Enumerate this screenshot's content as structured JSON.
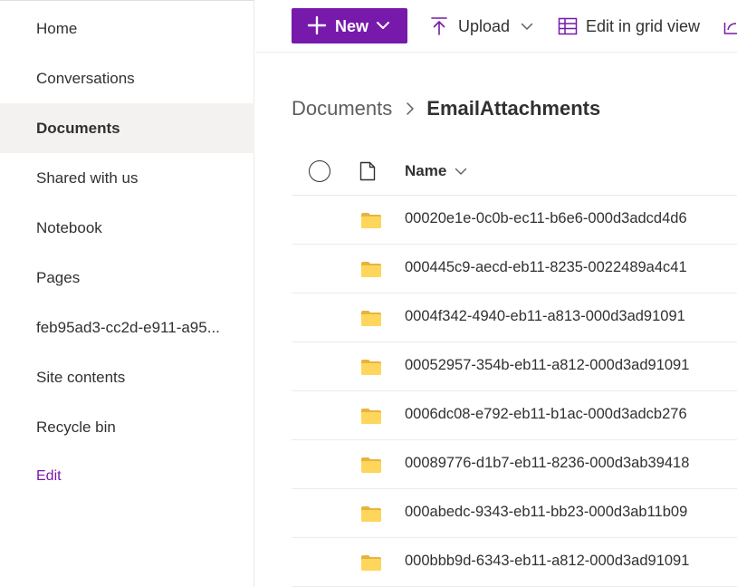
{
  "nav": {
    "items": [
      {
        "label": "Home",
        "selected": false
      },
      {
        "label": "Conversations",
        "selected": false
      },
      {
        "label": "Documents",
        "selected": true
      },
      {
        "label": "Shared with us",
        "selected": false
      },
      {
        "label": "Notebook",
        "selected": false
      },
      {
        "label": "Pages",
        "selected": false
      },
      {
        "label": "feb95ad3-cc2d-e911-a95...",
        "selected": false
      },
      {
        "label": "Site contents",
        "selected": false
      },
      {
        "label": "Recycle bin",
        "selected": false
      }
    ],
    "edit_label": "Edit"
  },
  "command_bar": {
    "new_label": "New",
    "upload_label": "Upload",
    "edit_grid_label": "Edit in grid view"
  },
  "breadcrumb": {
    "root": "Documents",
    "current": "EmailAttachments"
  },
  "list": {
    "name_header": "Name",
    "rows": [
      {
        "name": "00020e1e-0c0b-ec11-b6e6-000d3adcd4d6",
        "icon": "folder-icon"
      },
      {
        "name": "000445c9-aecd-eb11-8235-0022489a4c41",
        "icon": "folder-icon"
      },
      {
        "name": "0004f342-4940-eb11-a813-000d3ad91091",
        "icon": "folder-icon"
      },
      {
        "name": "00052957-354b-eb11-a812-000d3ad91091",
        "icon": "folder-icon"
      },
      {
        "name": "0006dc08-e792-eb11-b1ac-000d3adcb276",
        "icon": "folder-icon"
      },
      {
        "name": "00089776-d1b7-eb11-8236-000d3ab39418",
        "icon": "folder-icon"
      },
      {
        "name": "000abedc-9343-eb11-bb23-000d3ab11b09",
        "icon": "folder-icon"
      },
      {
        "name": "000bbb9d-6343-eb11-a812-000d3ad91091",
        "icon": "folder-icon"
      }
    ]
  },
  "colors": {
    "accent": "#7719aa",
    "selected_nav_bg": "#f3f2f1",
    "folder_yellow": "#ffd65c"
  }
}
